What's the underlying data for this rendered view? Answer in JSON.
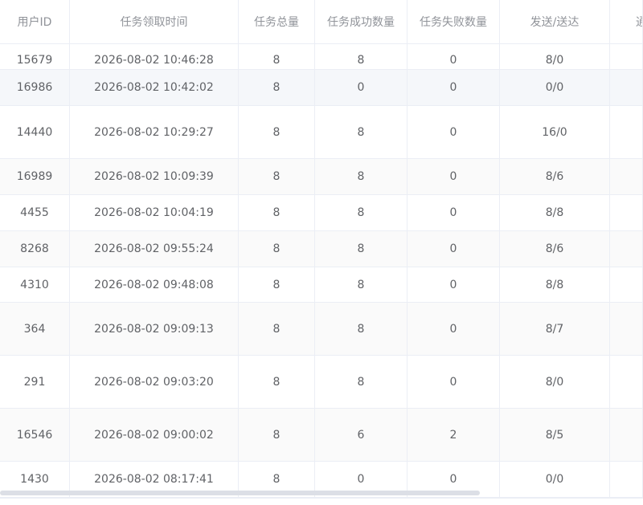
{
  "table": {
    "columns": [
      "用户ID",
      "任务领取时间",
      "任务总量",
      "任务成功数量",
      "任务失败数量",
      "发送/送达",
      "通"
    ],
    "rows": [
      [
        "15679",
        "2026-08-02 10:46:28",
        "8",
        "8",
        "0",
        "8/0",
        ""
      ],
      [
        "16986",
        "2026-08-02 10:42:02",
        "8",
        "0",
        "0",
        "0/0",
        ""
      ],
      [
        "14440",
        "2026-08-02 10:29:27",
        "8",
        "8",
        "0",
        "16/0",
        ""
      ],
      [
        "16989",
        "2026-08-02 10:09:39",
        "8",
        "8",
        "0",
        "8/6",
        ""
      ],
      [
        "4455",
        "2026-08-02 10:04:19",
        "8",
        "8",
        "0",
        "8/8",
        ""
      ],
      [
        "8268",
        "2026-08-02 09:55:24",
        "8",
        "8",
        "0",
        "8/6",
        ""
      ],
      [
        "4310",
        "2026-08-02 09:48:08",
        "8",
        "8",
        "0",
        "8/8",
        ""
      ],
      [
        "364",
        "2026-08-02 09:09:13",
        "8",
        "8",
        "0",
        "8/7",
        ""
      ],
      [
        "291",
        "2026-08-02 09:03:20",
        "8",
        "8",
        "0",
        "8/0",
        ""
      ],
      [
        "16546",
        "2026-08-02 09:00:02",
        "8",
        "6",
        "2",
        "8/5",
        ""
      ],
      [
        "1430",
        "2026-08-02 08:17:41",
        "8",
        "0",
        "0",
        "0/0",
        ""
      ]
    ]
  },
  "colors": {
    "header_text": "#909399",
    "cell_text": "#606266",
    "border": "#ebeef5",
    "stripe": "#fafafa",
    "hover": "#f5f7fa",
    "scrollbar": "#dcdfe6"
  }
}
